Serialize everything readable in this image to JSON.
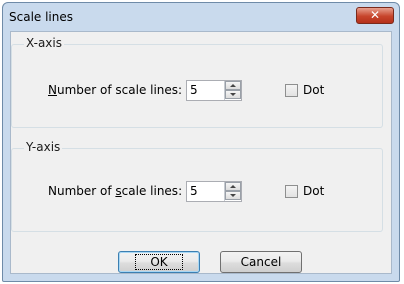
{
  "window": {
    "title": "Scale lines"
  },
  "xaxis": {
    "legend": "X-axis",
    "label_pre": "",
    "label_u": "N",
    "label_post": "umber of scale lines:",
    "value": "5",
    "dot_label": "Dot"
  },
  "yaxis": {
    "legend": "Y-axis",
    "label_pre": "Number of ",
    "label_u": "s",
    "label_post": "cale lines:",
    "value": "5",
    "dot_label": "Dot"
  },
  "buttons": {
    "ok": "OK",
    "cancel": "Cancel"
  }
}
